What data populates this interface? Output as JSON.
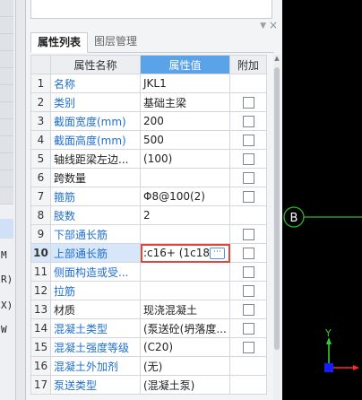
{
  "left_strip": {
    "fragments": [
      "M",
      "R)",
      "X)",
      "W"
    ]
  },
  "panel": {
    "tabs": [
      {
        "label": "属性列表",
        "active": true
      },
      {
        "label": "图层管理",
        "active": false
      }
    ],
    "columns": {
      "index": "",
      "name": "属性名称",
      "value": "属性值",
      "add": "附加"
    },
    "rows": [
      {
        "index": "1",
        "name": "名称",
        "value": "JKL1",
        "link": true,
        "checkbox": false
      },
      {
        "index": "2",
        "name": "类别",
        "value": "基础主梁",
        "link": true,
        "checkbox": true
      },
      {
        "index": "3",
        "name": "截面宽度(mm)",
        "value": "200",
        "link": true,
        "checkbox": true
      },
      {
        "index": "4",
        "name": "截面高度(mm)",
        "value": "500",
        "link": true,
        "checkbox": true
      },
      {
        "index": "5",
        "name": "轴线距梁左边...",
        "value": "(100)",
        "link": false,
        "checkbox": true
      },
      {
        "index": "6",
        "name": "跨数量",
        "value": "",
        "link": false,
        "checkbox": true
      },
      {
        "index": "7",
        "name": "箍筋",
        "value": "Φ8@100(2)",
        "link": true,
        "checkbox": true
      },
      {
        "index": "8",
        "name": "肢数",
        "value": "2",
        "link": true,
        "checkbox": false
      },
      {
        "index": "9",
        "name": "下部通长筋",
        "value": "",
        "link": true,
        "checkbox": true
      },
      {
        "index": "10",
        "name": "上部通长筋",
        "value": ":c16+ (1c18",
        "link": true,
        "checkbox": true,
        "selected": true
      },
      {
        "index": "11",
        "name": "侧面构造或受...",
        "value": "",
        "link": true,
        "checkbox": true
      },
      {
        "index": "12",
        "name": "拉筋",
        "value": "",
        "link": true,
        "checkbox": true
      },
      {
        "index": "13",
        "name": "材质",
        "value": "现浇混凝土",
        "link": false,
        "checkbox": true
      },
      {
        "index": "14",
        "name": "混凝土类型",
        "value": "(泵送砼(坍落度...",
        "link": true,
        "checkbox": true
      },
      {
        "index": "15",
        "name": "混凝土强度等级",
        "value": "(C20)",
        "link": true,
        "checkbox": true
      },
      {
        "index": "16",
        "name": "混凝土外加剂",
        "value": "(无)",
        "link": true,
        "checkbox": false
      },
      {
        "index": "17",
        "name": "泵送类型",
        "value": "(混凝土泵)",
        "link": true,
        "checkbox": false
      }
    ]
  },
  "canvas": {
    "axis_label": "B",
    "y_label": "Y",
    "colors": {
      "background": "#000000",
      "axis_line": "#2fb52f",
      "y_axis": "#2ed12e",
      "x_axis": "#ff2a2a",
      "origin": "#1a1aff"
    }
  }
}
